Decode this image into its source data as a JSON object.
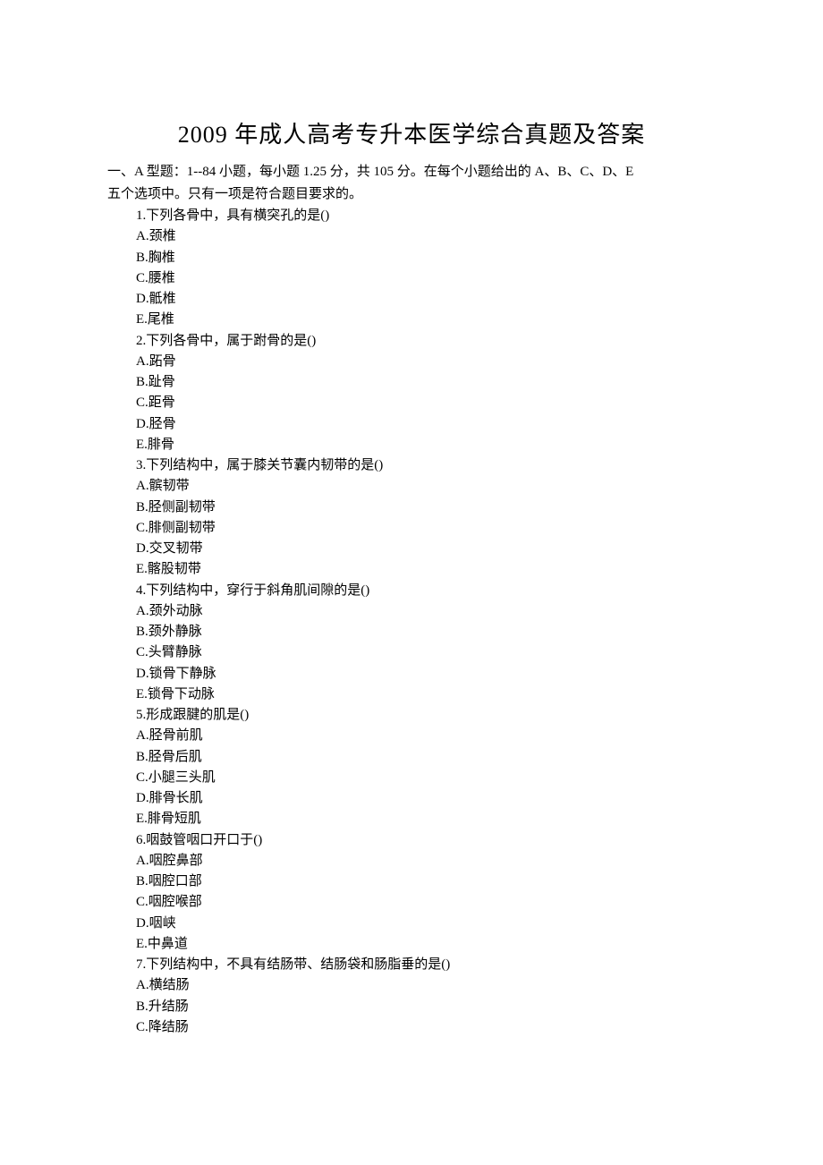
{
  "title": "2009 年成人高考专升本医学综合真题及答案",
  "instruction_line1": "一、A 型题：1--84 小题，每小题 1.25 分，共 105 分。在每个小题给出的 A、B、C、D、E",
  "instruction_line2": "五个选项中。只有一项是符合题目要求的。",
  "questions": [
    {
      "stem": "1.下列各骨中，具有横突孔的是()",
      "options": [
        "A.颈椎",
        "B.胸椎",
        "C.腰椎",
        "D.骶椎",
        "E.尾椎"
      ]
    },
    {
      "stem": "2.下列各骨中，属于跗骨的是()",
      "options": [
        "A.跖骨",
        "B.趾骨",
        "C.距骨",
        "D.胫骨",
        "E.腓骨"
      ]
    },
    {
      "stem": "3.下列结构中，属于膝关节囊内韧带的是()",
      "options": [
        "A.髌韧带",
        "B.胫侧副韧带",
        "C.腓侧副韧带",
        "D.交叉韧带",
        "E.髂股韧带"
      ]
    },
    {
      "stem": "4.下列结构中，穿行于斜角肌间隙的是()",
      "options": [
        "A.颈外动脉",
        "B.颈外静脉",
        "C.头臂静脉",
        "D.锁骨下静脉",
        "E.锁骨下动脉"
      ]
    },
    {
      "stem": "5.形成跟腱的肌是()",
      "options": [
        "A.胫骨前肌",
        "B.胫骨后肌",
        "C.小腿三头肌",
        "D.腓骨长肌",
        "E.腓骨短肌"
      ]
    },
    {
      "stem": "6.咽鼓管咽口开口于()",
      "options": [
        "A.咽腔鼻部",
        "B.咽腔口部",
        "C.咽腔喉部",
        "D.咽峡",
        "E.中鼻道"
      ]
    },
    {
      "stem": "7.下列结构中，不具有结肠带、结肠袋和肠脂垂的是()",
      "options": [
        "A.横结肠",
        "B.升结肠",
        "C.降结肠"
      ]
    }
  ]
}
